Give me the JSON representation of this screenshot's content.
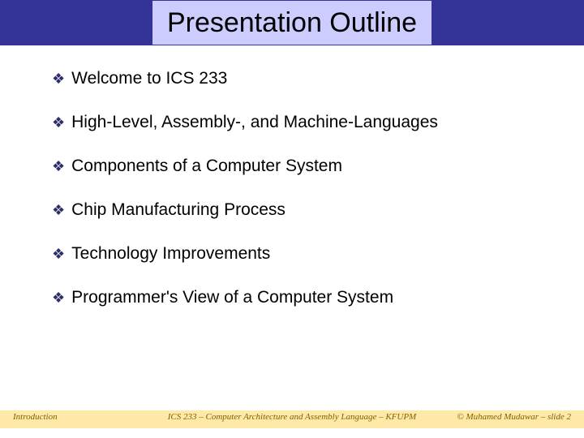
{
  "title": "Presentation Outline",
  "bullet_glyph": "❖",
  "items": [
    "Welcome to ICS 233",
    "High-Level, Assembly-, and Machine-Languages",
    "Components of a Computer System",
    "Chip Manufacturing Process",
    "Technology Improvements",
    "Programmer's View of a Computer System"
  ],
  "footer": {
    "left": "Introduction",
    "center": "ICS 233 – Computer Architecture and Assembly Language – KFUPM",
    "right": "© Muhamed Mudawar – slide 2"
  }
}
